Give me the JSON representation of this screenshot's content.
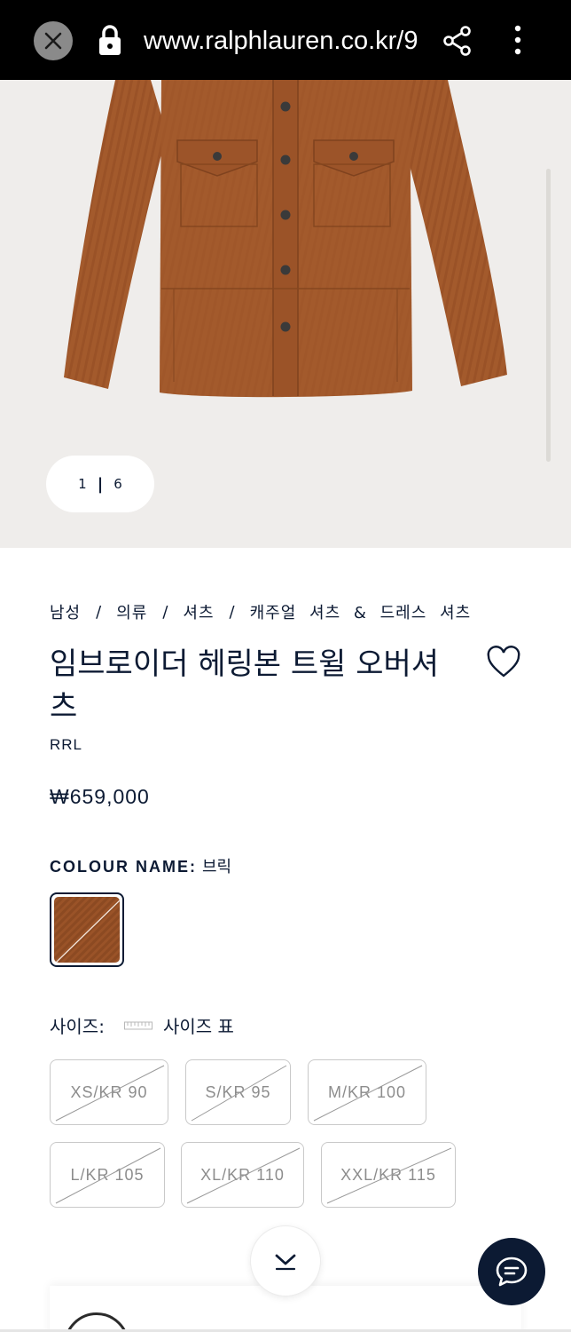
{
  "browser": {
    "url": "www.ralphlauren.co.kr/9"
  },
  "gallery": {
    "current": "1",
    "total": "6"
  },
  "breadcrumb": [
    "남성",
    "의류",
    "셔츠",
    "캐주얼 셔츠 & 드레스 셔츠"
  ],
  "product": {
    "title": "임브로이더 헤링본 트윌 오버셔츠",
    "brand": "RRL",
    "price": "₩659,000"
  },
  "colour": {
    "label": "COLOUR NAME:",
    "value": "브릭",
    "swatch_color": "#8c4a22"
  },
  "size": {
    "label": "사이즈:",
    "chart_label": "사이즈 표",
    "options": [
      {
        "label": "XS/KR 90",
        "available": false
      },
      {
        "label": "S/KR 95",
        "available": false
      },
      {
        "label": "M/KR 100",
        "available": false
      },
      {
        "label": "L/KR 105",
        "available": false
      },
      {
        "label": "XL/KR 110",
        "available": false
      },
      {
        "label": "XXL/KR 115",
        "available": false
      }
    ]
  },
  "colors": {
    "navy": "#0c1a33",
    "hero_bg": "#efedeb",
    "shirt": "#a35a2c"
  },
  "icons": [
    "close-icon",
    "lock-icon",
    "share-icon",
    "more-vert-icon",
    "heart-icon",
    "ruler-icon",
    "chevron-down-icon",
    "chat-icon"
  ]
}
